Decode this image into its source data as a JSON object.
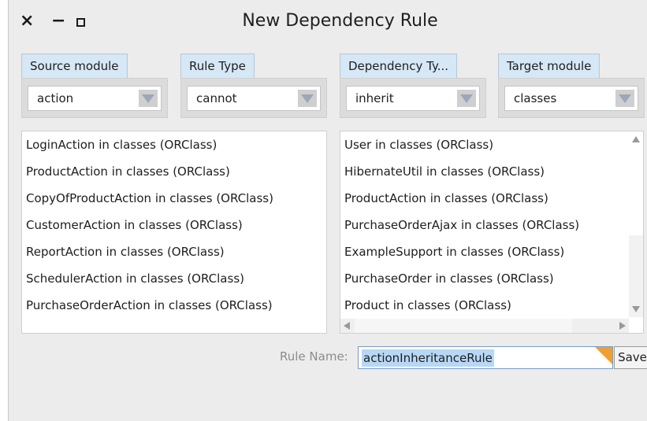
{
  "window": {
    "title": "New Dependency Rule",
    "controls": {
      "close": "×",
      "minimize": "−"
    }
  },
  "selectors": [
    {
      "tab": "Source module",
      "value": "action"
    },
    {
      "tab": "Rule Type",
      "value": "cannot"
    },
    {
      "tab": "Dependency Ty...",
      "value": "inherit"
    },
    {
      "tab": "Target module",
      "value": "classes"
    }
  ],
  "source_list": [
    "LoginAction in classes (ORClass)",
    "ProductAction in classes (ORClass)",
    "CopyOfProductAction in classes (ORClass)",
    "CustomerAction in classes (ORClass)",
    "ReportAction in classes (ORClass)",
    "SchedulerAction in classes (ORClass)",
    "PurchaseOrderAction in classes (ORClass)"
  ],
  "target_list": [
    "User in classes (ORClass)",
    "HibernateUtil in classes (ORClass)",
    "ProductAction in classes (ORClass)",
    "PurchaseOrderAjax in classes (ORClass)",
    "ExampleSupport in classes (ORClass)",
    "PurchaseOrder in classes (ORClass)",
    "Product in classes (ORClass)"
  ],
  "rule_name": {
    "label": "Rule Name:",
    "value": "actionInheritanceRule"
  },
  "save_label": "Save"
}
